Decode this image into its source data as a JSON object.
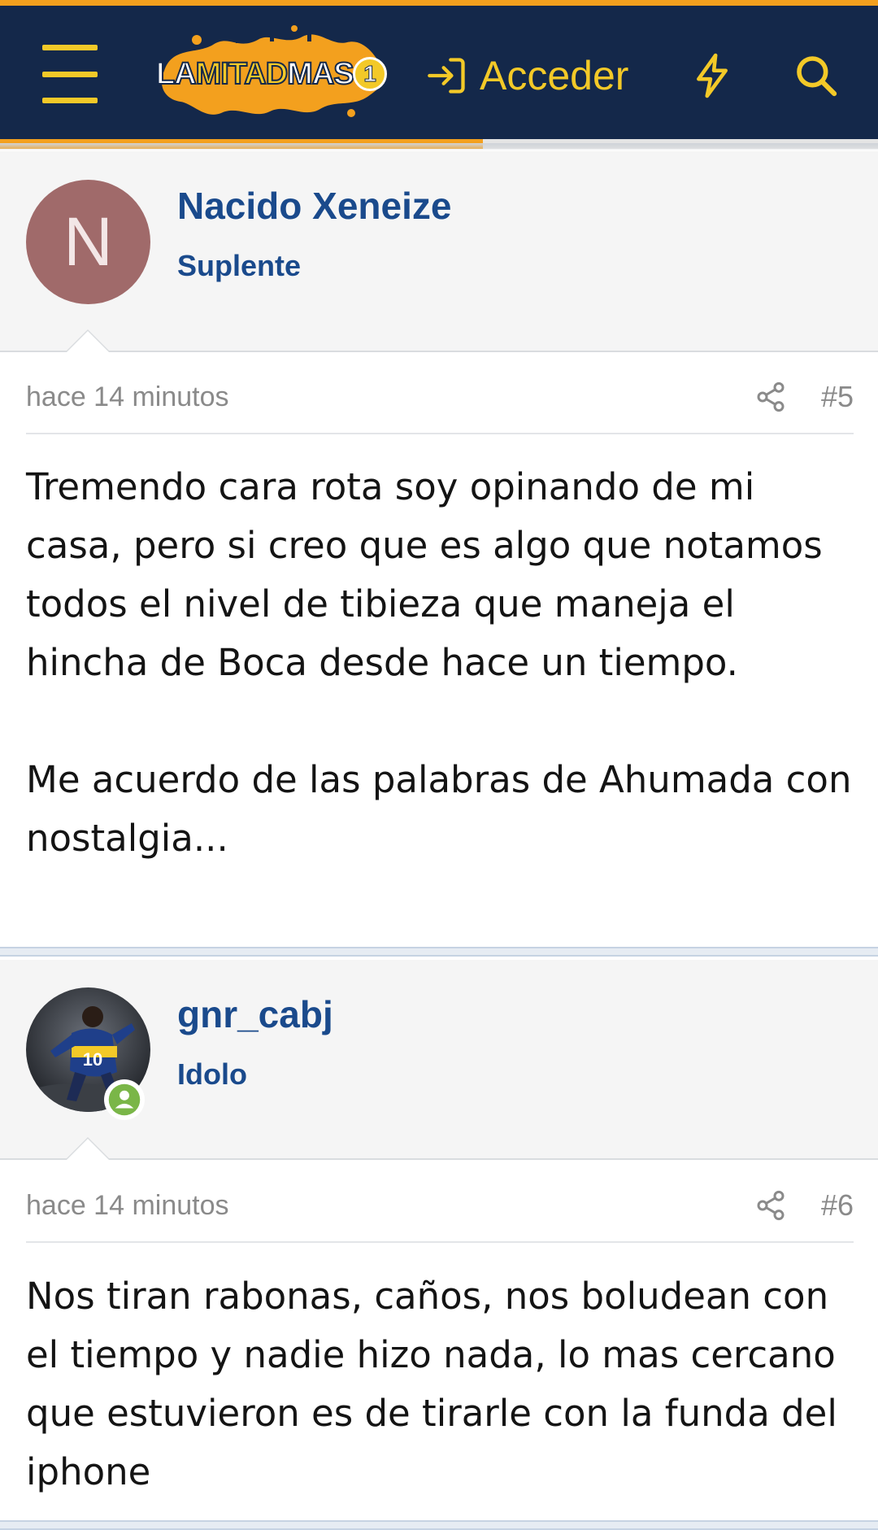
{
  "header": {
    "menu_icon": "hamburger-menu-icon",
    "logo": {
      "part1": "LA",
      "part2": "MITAD",
      "part3": "MAS",
      "badge": "1"
    },
    "login_label": "Acceder",
    "login_icon": "sign-in-icon",
    "whats_new_icon": "bolt-icon",
    "search_icon": "search-icon",
    "read_progress": 0.55,
    "colors": {
      "bar": "#14284a",
      "accent": "#f3a01e",
      "icon": "#f3c928"
    }
  },
  "posts": [
    {
      "username": "Nacido Xeneize",
      "user_title": "Suplente",
      "avatar_letter": "N",
      "avatar_color": "#a06a6a",
      "date": "hace 14 minutos",
      "number": "#5",
      "body": "Tremendo cara rota soy opinando de mi casa, pero si creo que es algo que notamos todos el nivel de tibieza que maneja el hincha de Boca desde hace un tiempo.\n\nMe acuerdo de las palabras de Ahumada con nostalgia..."
    },
    {
      "username": "gnr_cabj",
      "user_title": "Idolo",
      "avatar_jersey_number": "10",
      "online": true,
      "date": "hace 14 minutos",
      "number": "#6",
      "body": "Nos tiran rabonas, caños, nos boludean con el tiempo y nadie hizo nada, lo mas cercano que estuvieron es de tirarle con la funda del iphone"
    }
  ]
}
